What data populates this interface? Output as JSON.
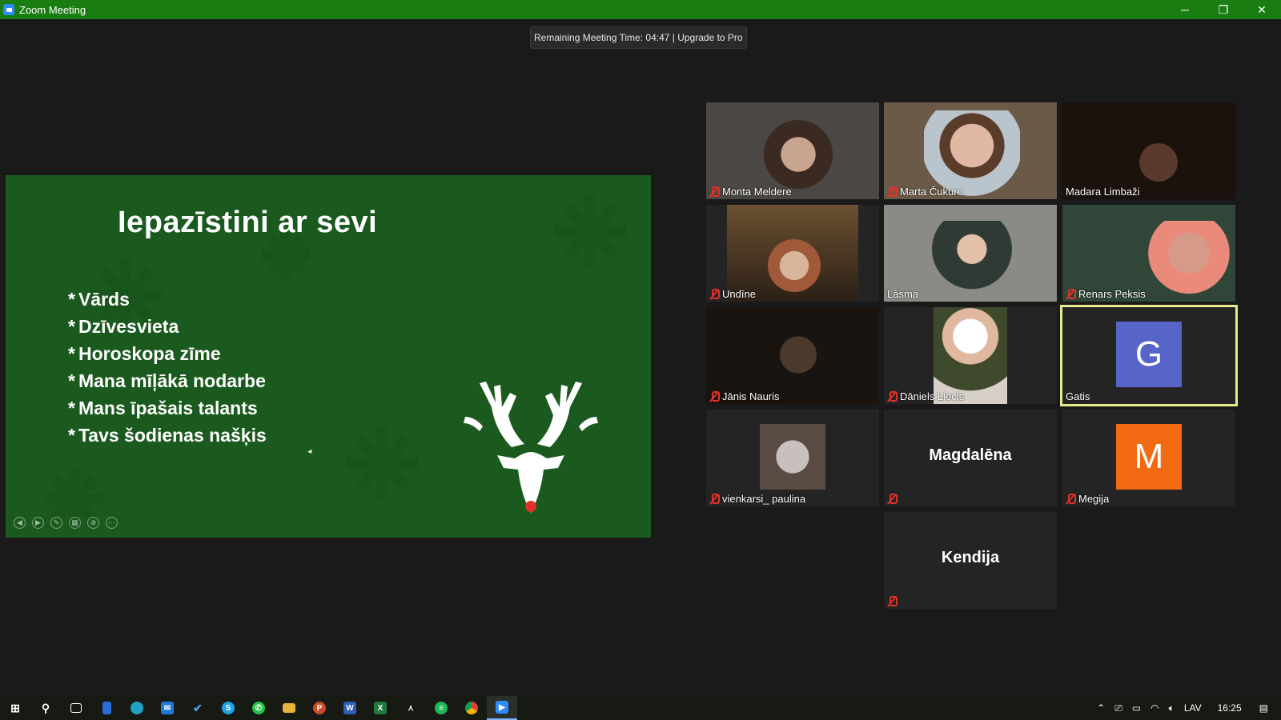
{
  "window": {
    "title": "Zoom Meeting",
    "minimize": "─",
    "maximize": "❐",
    "close": "✕"
  },
  "meeting": {
    "timer_text": "Remaining Meeting Time: 04:47 | Upgrade to Pro"
  },
  "slide": {
    "title": "Iepazīstini ar sevi",
    "bullets": [
      "Vārds",
      "Dzīvesvieta",
      "Horoskopa zīme",
      "Mana mīļākā nodarbe",
      "Mans īpašais talants",
      "Tavs šodienas našķis"
    ],
    "bullet_marker": "*",
    "background_color": "#1b5a1e",
    "nose_color": "#e0312c"
  },
  "participants": [
    {
      "name": "Monta Meldere",
      "muted": true,
      "kind": "video"
    },
    {
      "name": "Marta Čukure",
      "muted": true,
      "kind": "video"
    },
    {
      "name": "Madara Limbaži",
      "muted": false,
      "kind": "video"
    },
    {
      "name": "Undīne",
      "muted": true,
      "kind": "video"
    },
    {
      "name": "Lāsma",
      "muted": false,
      "kind": "video"
    },
    {
      "name": "Renars Peksis",
      "muted": true,
      "kind": "video"
    },
    {
      "name": "Jānis Nauris",
      "muted": true,
      "kind": "video"
    },
    {
      "name": "Dāniels Liecis",
      "muted": true,
      "kind": "video"
    },
    {
      "name": "Gatis",
      "muted": false,
      "kind": "avatar",
      "initial": "G",
      "avatar_color": "#5865c8",
      "active_speaker": true
    },
    {
      "name": "vienkarsi_ paulina",
      "muted": true,
      "kind": "photo"
    },
    {
      "name": "Magdalēna",
      "muted": true,
      "kind": "name-only",
      "label": ""
    },
    {
      "name": "Megija",
      "muted": true,
      "kind": "avatar",
      "initial": "M",
      "avatar_color": "#f26b12"
    },
    {
      "name": "Kendija",
      "muted": true,
      "kind": "name-only"
    }
  ],
  "taskbar": {
    "apps": [
      "start-icon",
      "search-icon",
      "task-view-icon",
      "notepad-icon",
      "edge-icon",
      "mail-icon",
      "todo-icon",
      "skype-icon",
      "whatsapp-icon",
      "file-explorer-icon",
      "powerpoint-icon",
      "word-icon",
      "excel-icon",
      "acrobat-icon",
      "spotify-icon",
      "chrome-icon",
      "zoom-icon"
    ],
    "language": "LAV",
    "time": "16:25"
  }
}
